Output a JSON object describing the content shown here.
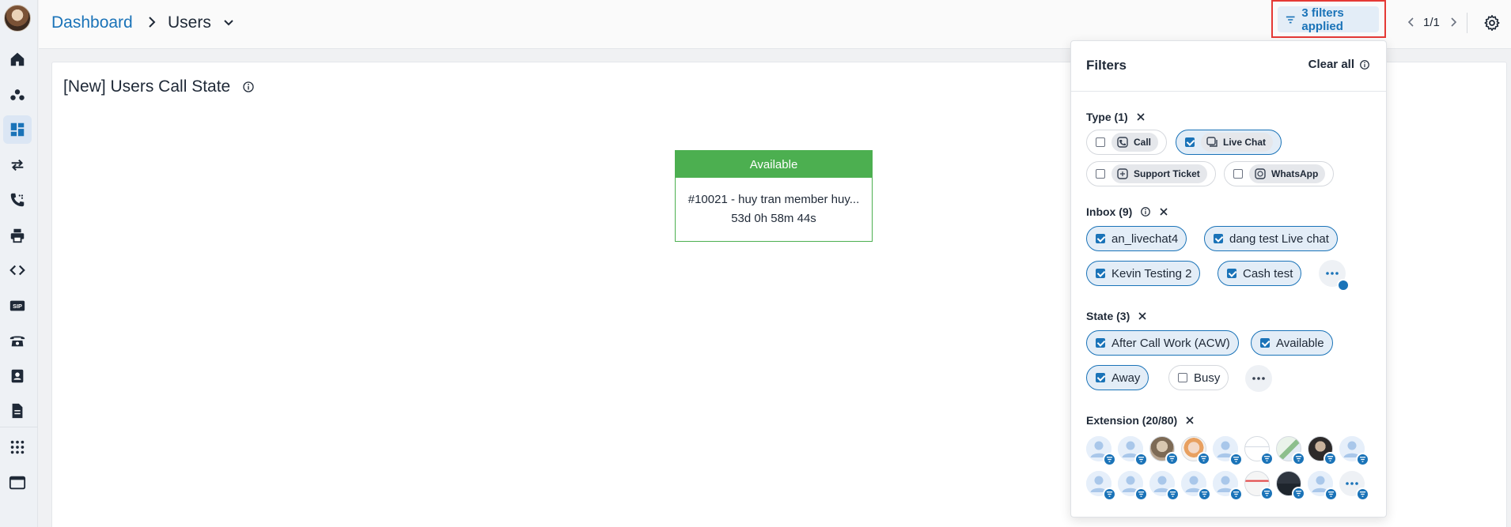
{
  "breadcrumb": {
    "root": "Dashboard",
    "current": "Users"
  },
  "header": {
    "filter_button_label": "3 filters applied",
    "pager": "1/1"
  },
  "panel": {
    "title": "[New] Users Call State",
    "card": {
      "status": "Available",
      "status_color": "#4caf50",
      "name": "#10021 - huy tran member huy...",
      "duration": "53d 0h 58m 44s"
    }
  },
  "filters": {
    "title": "Filters",
    "clear_all": "Clear all",
    "type": {
      "label": "Type (1)",
      "options": [
        {
          "label": "Call",
          "checked": false
        },
        {
          "label": "Live Chat",
          "checked": true
        },
        {
          "label": "Support Ticket",
          "checked": false
        },
        {
          "label": "WhatsApp",
          "checked": false
        }
      ]
    },
    "inbox": {
      "label": "Inbox (9)",
      "options": [
        {
          "label": "an_livechat4",
          "checked": true
        },
        {
          "label": "dang test Live chat",
          "checked": true
        },
        {
          "label": "Kevin Testing 2",
          "checked": true
        },
        {
          "label": "Cash test",
          "checked": true
        }
      ]
    },
    "state": {
      "label": "State (3)",
      "options": [
        {
          "label": "After Call Work (ACW)",
          "checked": true
        },
        {
          "label": "Available",
          "checked": true
        },
        {
          "label": "Away",
          "checked": true
        },
        {
          "label": "Busy",
          "checked": false
        }
      ]
    },
    "extension": {
      "label": "Extension (20/80)"
    }
  },
  "colors": {
    "accent": "#1a73b8",
    "highlight_border": "#e53935",
    "available": "#4caf50"
  }
}
